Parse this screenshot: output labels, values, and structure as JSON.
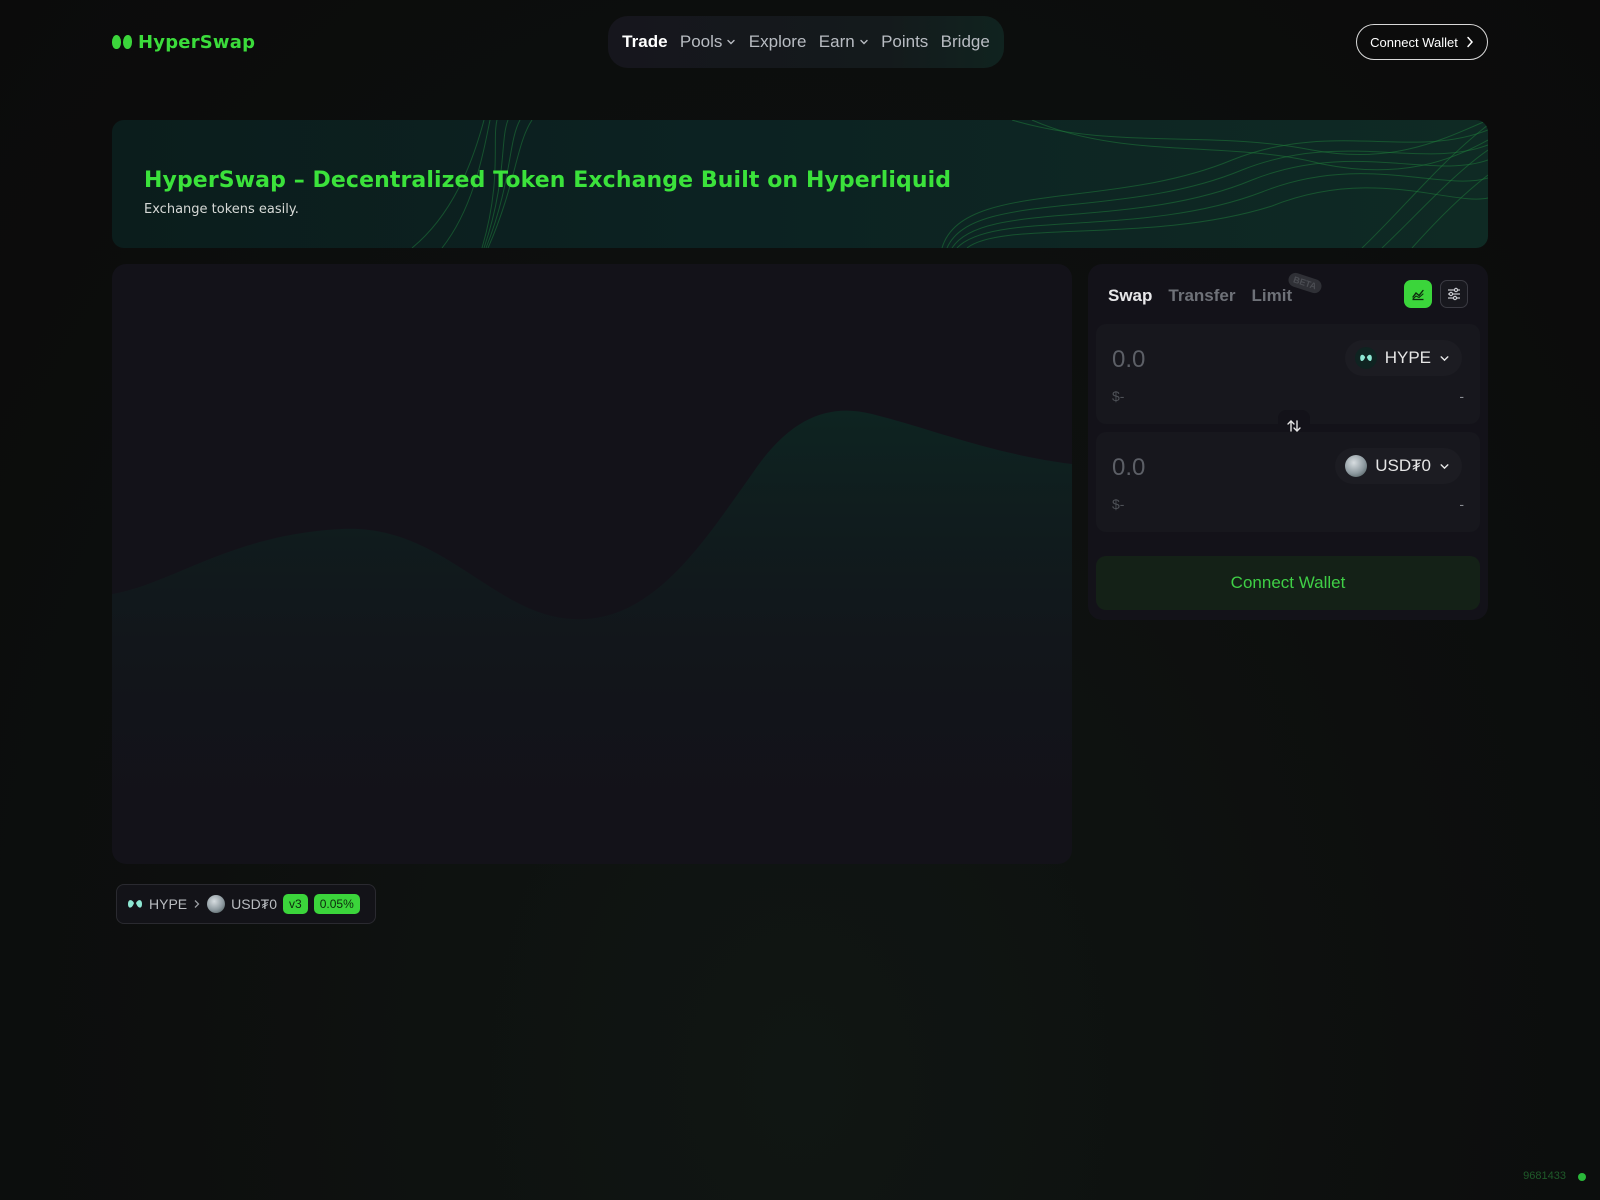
{
  "brand": {
    "name": "HyperSwap",
    "accent": "#3bdc3b"
  },
  "nav": {
    "items": [
      {
        "label": "Trade",
        "active": true,
        "dropdown": false
      },
      {
        "label": "Pools",
        "active": false,
        "dropdown": true
      },
      {
        "label": "Explore",
        "active": false,
        "dropdown": false
      },
      {
        "label": "Earn",
        "active": false,
        "dropdown": true
      },
      {
        "label": "Points",
        "active": false,
        "dropdown": false
      },
      {
        "label": "Bridge",
        "active": false,
        "dropdown": false
      }
    ]
  },
  "header": {
    "connect_label": "Connect Wallet",
    "connect_icon": "chevron-right-icon"
  },
  "banner": {
    "title": "HyperSwap – Decentralized Token Exchange Built on Hyperliquid",
    "subtitle": "Exchange tokens easily."
  },
  "route": {
    "from_token": "HYPE",
    "to_token": "USD₮0",
    "version": "v3",
    "fee": "0.05%"
  },
  "swap": {
    "tabs": [
      {
        "label": "Swap",
        "active": true
      },
      {
        "label": "Transfer",
        "active": false
      },
      {
        "label": "Limit",
        "active": false,
        "badge": "BETA"
      }
    ],
    "chart_toggle_icon": "chart-icon",
    "settings_icon": "sliders-icon",
    "sell": {
      "placeholder": "0.0",
      "usd": "$-",
      "balance": "-",
      "token": "HYPE"
    },
    "buy": {
      "placeholder": "0.0",
      "usd": "$-",
      "balance": "-",
      "token": "USD₮0"
    },
    "flip_icon": "swap-arrows-icon",
    "connect_label": "Connect Wallet"
  },
  "footer": {
    "block": "9681433",
    "status_color": "#2ab83a"
  }
}
